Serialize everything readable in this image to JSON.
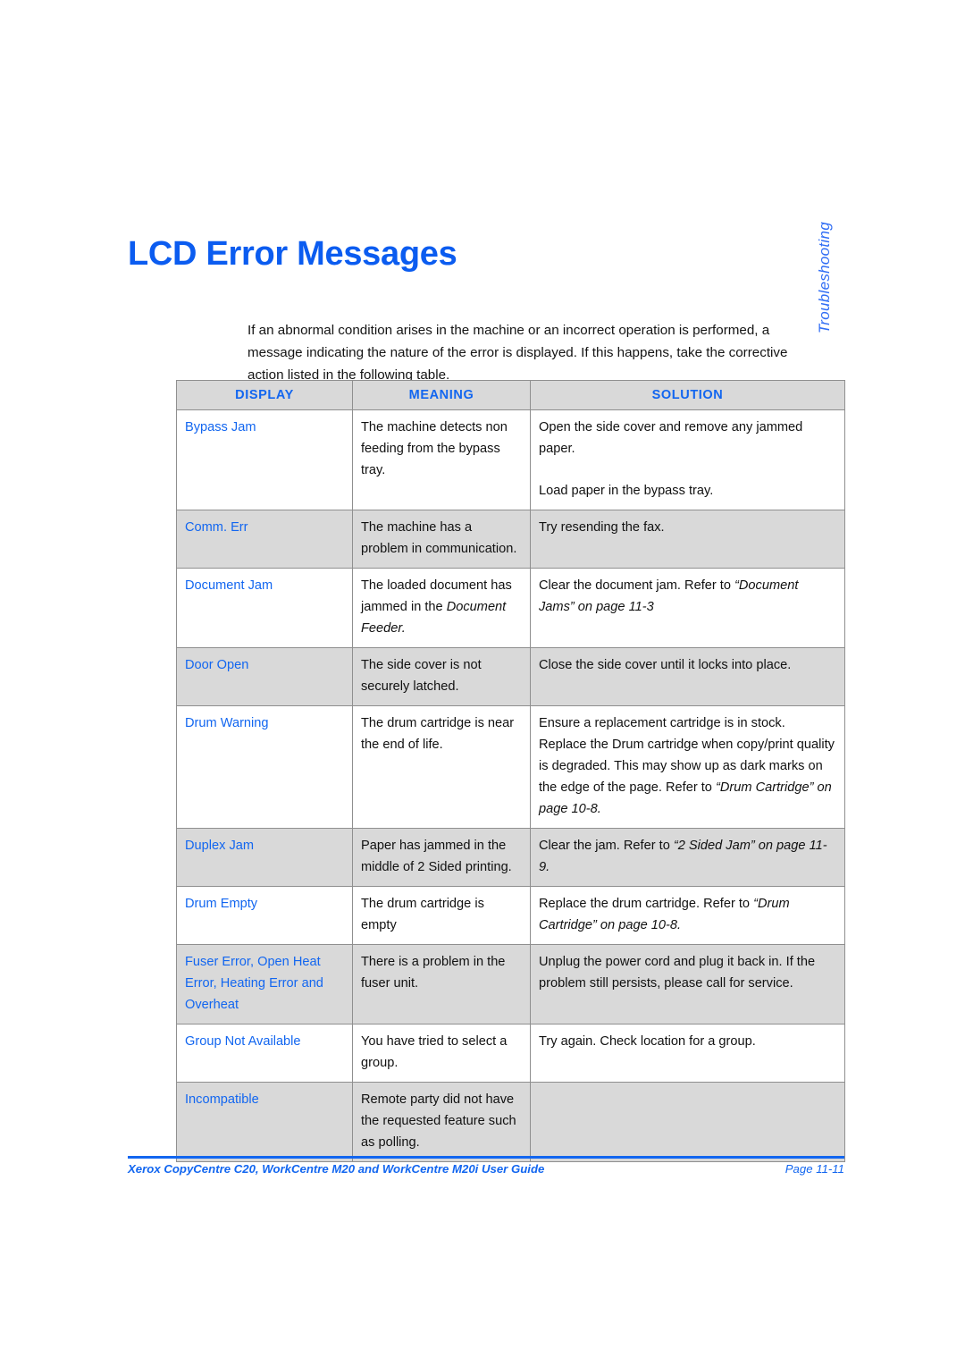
{
  "page": {
    "title": "LCD Error Messages",
    "chapter_tab": "Troubleshooting",
    "intro": "If an abnormal condition arises in the machine or an incorrect operation is performed, a message indicating the nature of the error is displayed. If this happens, take the corrective action listed in the following table.",
    "accent_color": "#1266f0",
    "header_fill": "#d9d9d9",
    "border_color": "#8f8f8f"
  },
  "table": {
    "headers": {
      "display": "DISPLAY",
      "meaning": "MEANING",
      "solution": "SOLUTION"
    },
    "rows": [
      {
        "display": "Bypass Jam",
        "meaning": "The machine detects non feeding from the bypass tray.",
        "solution_p1": "Open the side cover and remove any jammed paper.",
        "solution_p2": "Load paper in the bypass tray.",
        "shaded": false
      },
      {
        "display": "Comm. Err",
        "meaning": "The machine has a problem in communication.",
        "solution_p1": "Try resending the fax.",
        "solution_p2": "",
        "shaded": true
      },
      {
        "display": "Document Jam",
        "meaning_plain": "The loaded document has jammed in the ",
        "meaning_italic": "Document Feeder.",
        "solution_plain": "Clear the document jam. Refer to ",
        "solution_italic": "“Document Jams” on page 11-3",
        "shaded": false
      },
      {
        "display": "Door Open",
        "meaning": "The side cover is not securely latched.",
        "solution_p1": "Close the side cover until it locks into place.",
        "solution_p2": "",
        "shaded": true
      },
      {
        "display": "Drum Warning",
        "meaning": "The drum cartridge is near the end of life.",
        "solution_plain": "Ensure a replacement cartridge is in stock. Replace the Drum cartridge when copy/print quality is degraded. This may show up as dark marks on the edge of the page. Refer to ",
        "solution_italic": "“Drum Cartridge” on page 10-8.",
        "shaded": false
      },
      {
        "display": "Duplex Jam",
        "meaning": "Paper has jammed in the middle of 2 Sided printing.",
        "solution_plain": "Clear the jam. Refer to ",
        "solution_italic": "“2 Sided Jam” on page 11-9.",
        "shaded": true
      },
      {
        "display": "Drum Empty",
        "meaning": "The drum cartridge is empty",
        "solution_plain": "Replace the drum cartridge. Refer to ",
        "solution_italic": "“Drum Cartridge” on page 10-8.",
        "shaded": false
      },
      {
        "display": "Fuser Error, Open Heat Error, Heating Error and Overheat",
        "meaning": "There is a problem in the fuser unit.",
        "solution_p1": "Unplug the power cord and plug it back in. If the problem still persists, please call for service.",
        "solution_p2": "",
        "shaded": true
      },
      {
        "display": "Group Not Available",
        "meaning": "You have tried to select a group.",
        "solution_p1": "Try again. Check location for a group.",
        "solution_p2": "",
        "shaded": false
      },
      {
        "display": "Incompatible",
        "meaning": "Remote party did not have the requested feature such as polling.",
        "solution_p1": "",
        "solution_p2": "",
        "shaded": true
      }
    ]
  },
  "footer": {
    "left": "Xerox CopyCentre C20, WorkCentre M20 and WorkCentre M20i User Guide",
    "right": "Page 11-11"
  }
}
